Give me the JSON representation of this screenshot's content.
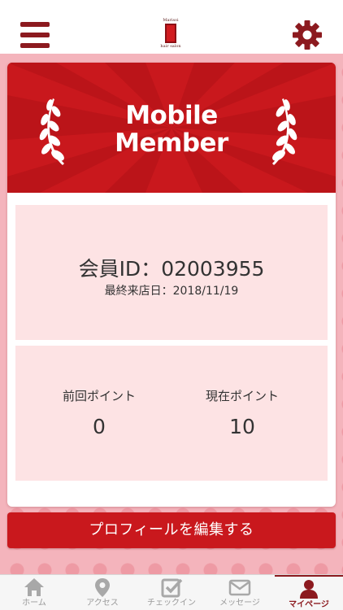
{
  "header": {
    "logo_top": "Marisoi",
    "logo_bottom": "hair salon",
    "menu_icon": "hamburger-menu-icon",
    "settings_icon": "gear-icon"
  },
  "banner": {
    "title_line1": "Mobile",
    "title_line2": "Member",
    "icon": "laurel-icon"
  },
  "member": {
    "id_label": "会員ID：",
    "id_value": "02003955",
    "last_visit_label": "最終来店日：",
    "last_visit_date": "2018/11/19"
  },
  "points": {
    "previous_label": "前回ポイント",
    "previous_value": "0",
    "current_label": "現在ポイント",
    "current_value": "10"
  },
  "edit_profile_label": "プロフィールを編集する",
  "tabs": [
    {
      "label": "ホーム",
      "icon": "home-icon",
      "active": false
    },
    {
      "label": "アクセス",
      "icon": "location-pin-icon",
      "active": false
    },
    {
      "label": "チェックイン",
      "icon": "checkin-icon",
      "active": false
    },
    {
      "label": "メッセージ",
      "icon": "envelope-icon",
      "active": false
    },
    {
      "label": "マイページ",
      "icon": "user-icon",
      "active": true
    }
  ],
  "colors": {
    "brand_dark": "#8c1a1f",
    "brand_red": "#c9181d",
    "pattern_pink": "#f4b4bc",
    "panel_pink": "#fde3e4"
  }
}
